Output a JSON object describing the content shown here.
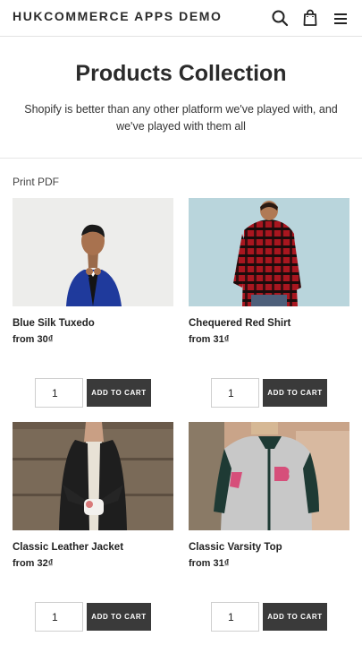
{
  "header": {
    "brand": "HUKCOMMERCE APPS DEMO",
    "icons": [
      "search-icon",
      "cart-bag-icon",
      "menu-icon"
    ]
  },
  "hero": {
    "title": "Products Collection",
    "subtitle": "Shopify is better than any other platform we've played with, and we've played with them all"
  },
  "toolbar": {
    "print_label": "Print PDF"
  },
  "products": [
    {
      "title": "Blue Silk Tuxedo",
      "price": "from 30₫",
      "qty": "1",
      "button": "ADD TO CART"
    },
    {
      "title": "Chequered Red Shirt",
      "price": "from 31₫",
      "qty": "1",
      "button": "ADD TO CART"
    },
    {
      "title": "Classic Leather Jacket",
      "price": "from 32₫",
      "qty": "1",
      "button": "ADD TO CART"
    },
    {
      "title": "Classic Varsity Top",
      "price": "from 31₫",
      "qty": "1",
      "button": "ADD TO CART"
    }
  ],
  "colors": {
    "button_bg": "#3a3a3a",
    "text": "#222222",
    "border": "#e3e3e3"
  }
}
